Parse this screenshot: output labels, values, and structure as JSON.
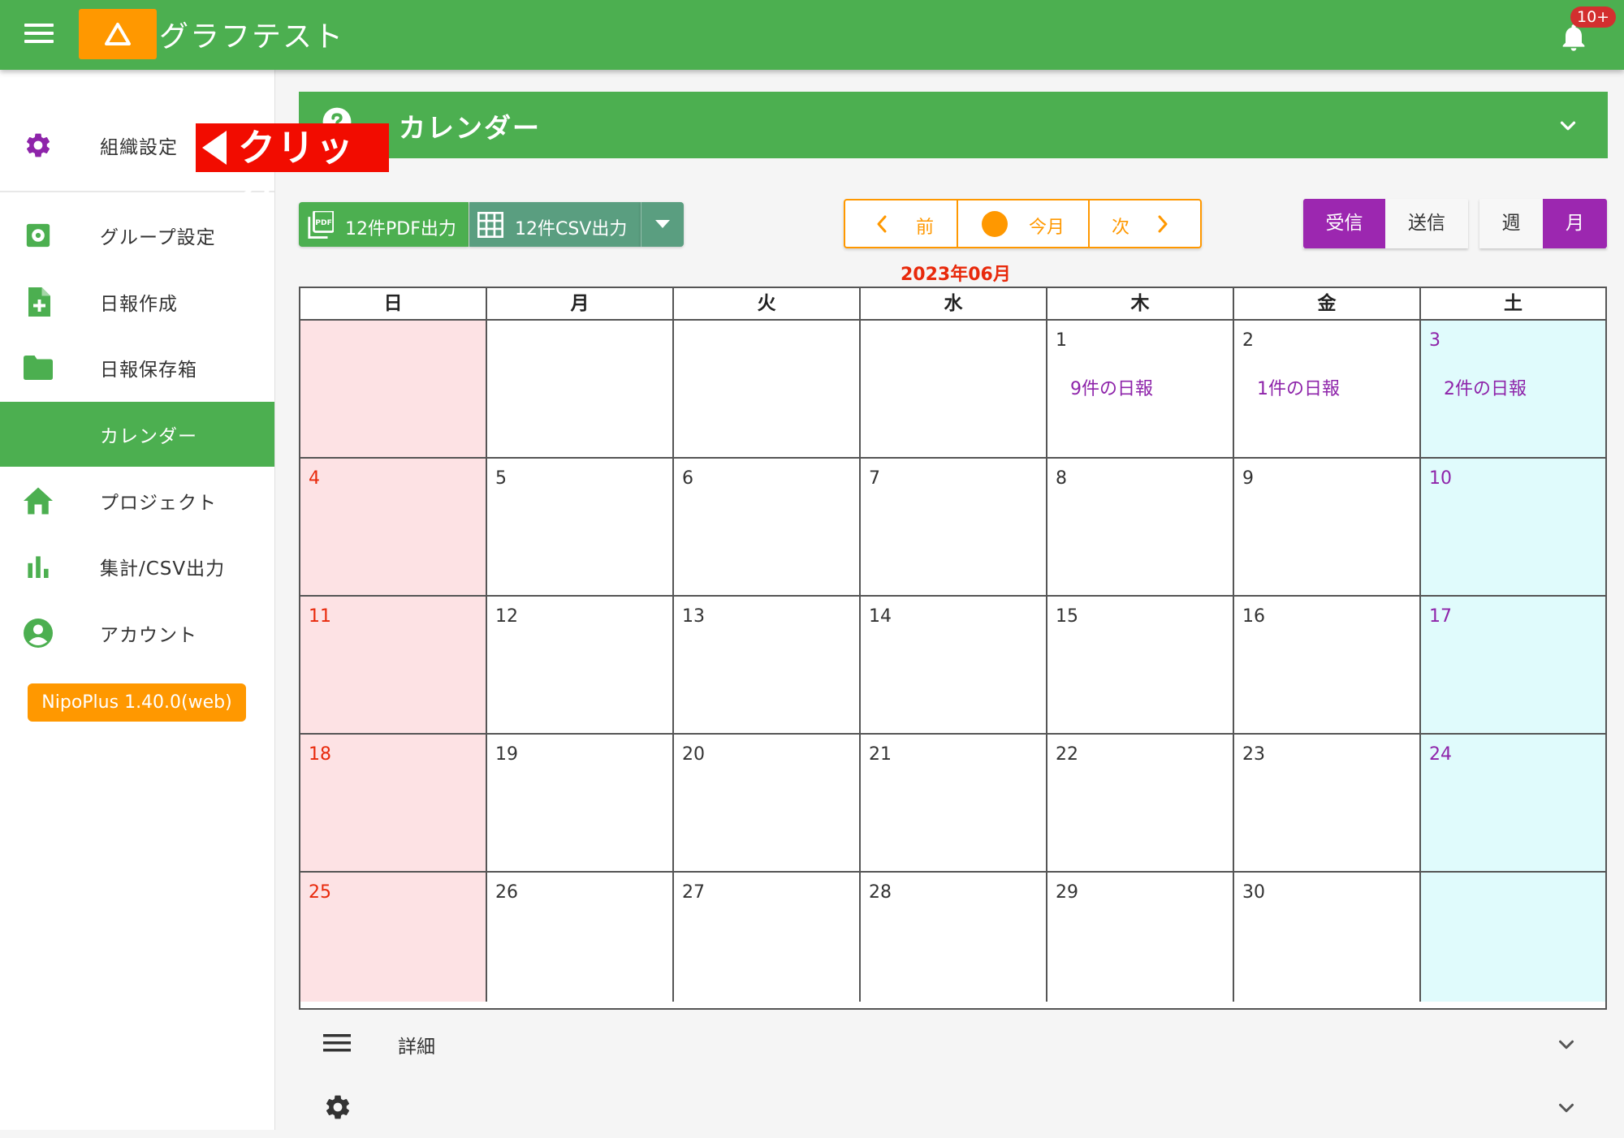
{
  "app": {
    "title": "グラフテスト",
    "notification_badge": "10+"
  },
  "sidebar": {
    "items": [
      {
        "label": "組織設定",
        "icon": "gear-icon"
      },
      {
        "label": "グループ設定",
        "icon": "settings-box-icon"
      },
      {
        "label": "日報作成",
        "icon": "file-plus-icon"
      },
      {
        "label": "日報保存箱",
        "icon": "folder-icon"
      },
      {
        "label": "カレンダー",
        "icon": "",
        "active": true
      },
      {
        "label": "プロジェクト",
        "icon": "home-icon"
      },
      {
        "label": "集計/CSV出力",
        "icon": "bar-chart-icon"
      },
      {
        "label": "アカウント",
        "icon": "account-circle-icon"
      }
    ],
    "version": "NipoPlus 1.40.0(web)"
  },
  "callout": {
    "text": "クリック"
  },
  "panel": {
    "title": "カレンダー"
  },
  "toolbar": {
    "pdf_label": "12件PDF出力",
    "csv_label": "12件CSV出力",
    "prev": "前",
    "today": "今月",
    "next": "次",
    "received": "受信",
    "sent": "送信",
    "week": "週",
    "month": "月"
  },
  "calendar": {
    "month_label": "2023年06月",
    "weekdays": [
      "日",
      "月",
      "火",
      "水",
      "木",
      "金",
      "土"
    ],
    "weeks": [
      [
        {
          "d": ""
        },
        {
          "d": ""
        },
        {
          "d": ""
        },
        {
          "d": ""
        },
        {
          "d": "1",
          "r": "9件の日報"
        },
        {
          "d": "2",
          "r": "1件の日報"
        },
        {
          "d": "3",
          "r": "2件の日報"
        }
      ],
      [
        {
          "d": "4"
        },
        {
          "d": "5"
        },
        {
          "d": "6"
        },
        {
          "d": "7"
        },
        {
          "d": "8"
        },
        {
          "d": "9"
        },
        {
          "d": "10"
        }
      ],
      [
        {
          "d": "11"
        },
        {
          "d": "12"
        },
        {
          "d": "13"
        },
        {
          "d": "14"
        },
        {
          "d": "15"
        },
        {
          "d": "16"
        },
        {
          "d": "17"
        }
      ],
      [
        {
          "d": "18"
        },
        {
          "d": "19"
        },
        {
          "d": "20"
        },
        {
          "d": "21"
        },
        {
          "d": "22"
        },
        {
          "d": "23"
        },
        {
          "d": "24"
        }
      ],
      [
        {
          "d": "25"
        },
        {
          "d": "26"
        },
        {
          "d": "27"
        },
        {
          "d": "28"
        },
        {
          "d": "29"
        },
        {
          "d": "30"
        },
        {
          "d": ""
        }
      ]
    ]
  },
  "bottom": {
    "details_label": "詳細"
  },
  "colors": {
    "primary": "#4caf50",
    "accent": "#ff9800",
    "purple": "#9c27b0",
    "sunday_bg": "#fde2e4",
    "saturday_bg": "#e0fbfc",
    "sunday_text": "#e8290b"
  }
}
